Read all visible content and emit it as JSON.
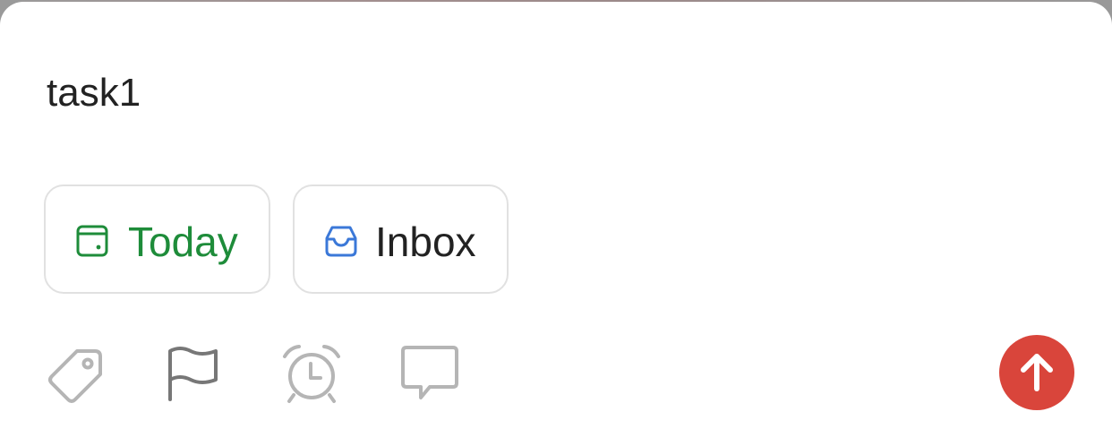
{
  "task_input": {
    "value": "task1",
    "placeholder": ""
  },
  "chips": {
    "due": {
      "label": "Today",
      "icon": "calendar-today-icon",
      "color": "#1e8c3a"
    },
    "project": {
      "label": "Inbox",
      "icon": "inbox-icon",
      "color": "#3b78d8"
    }
  },
  "toolbar": {
    "icons": [
      "label-icon",
      "flag-icon",
      "alarm-icon",
      "comment-icon"
    ],
    "icon_color": "#b5b5b5",
    "flag_color": "#777777"
  },
  "submit": {
    "icon": "arrow-up-icon",
    "color": "#d9453b"
  }
}
